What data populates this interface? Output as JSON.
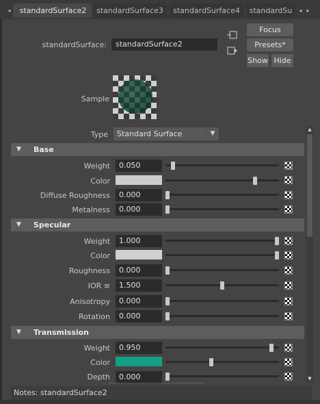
{
  "tabs": [
    {
      "label": "standardSurface2",
      "active": true
    },
    {
      "label": "standardSurface3",
      "active": false
    },
    {
      "label": "standardSurface4",
      "active": false
    },
    {
      "label": "standardSu",
      "active": false
    }
  ],
  "header": {
    "node_label": "standardSurface:",
    "node_value": "standardSurface2",
    "focus": "Focus",
    "presets": "Presets*",
    "show": "Show",
    "hide": "Hide",
    "sample_label": "Sample"
  },
  "type_row": {
    "label": "Type",
    "value": "Standard Surface"
  },
  "sections": {
    "base": {
      "title": "Base",
      "weight_label": "Weight",
      "weight_value": "0.050",
      "weight_slider": 0.05,
      "color_label": "Color",
      "color_value": "#cccccc",
      "color_slider": 0.8,
      "diffuse_roughness_label": "Diffuse Roughness",
      "diffuse_roughness_value": "0.000",
      "diffuse_roughness_slider": 0.0,
      "metalness_label": "Metalness",
      "metalness_value": "0.000",
      "metalness_slider": 0.0
    },
    "specular": {
      "title": "Specular",
      "weight_label": "Weight",
      "weight_value": "1.000",
      "weight_slider": 1.0,
      "color_label": "Color",
      "color_value": "#d0d0d0",
      "color_slider": 1.0,
      "roughness_label": "Roughness",
      "roughness_value": "0.000",
      "roughness_slider": 0.0,
      "ior_label": "IOR ≡",
      "ior_value": "1.500",
      "ior_slider": 0.5,
      "anisotropy_label": "Anisotropy",
      "anisotropy_value": "0.000",
      "anisotropy_slider": 0.0,
      "rotation_label": "Rotation",
      "rotation_value": "0.000",
      "rotation_slider": 0.0
    },
    "transmission": {
      "title": "Transmission",
      "weight_label": "Weight",
      "weight_value": "0.950",
      "weight_slider": 0.95,
      "color_label": "Color",
      "color_value": "#13a085",
      "color_slider": 0.4,
      "depth_label": "Depth",
      "depth_value": "0.000",
      "depth_slider": 0.0
    }
  },
  "notes": {
    "label": "Notes:",
    "value": "standardSurface2"
  },
  "colors": {
    "panel_bg": "#444444",
    "section_bg": "#5d5d5d",
    "field_bg": "#2b2b2b",
    "transmission_color": "#13a085"
  },
  "icons": {
    "input_connection": "arrow-in-icon",
    "output_connection": "arrow-out-icon",
    "map_button": "checker-map-icon"
  }
}
